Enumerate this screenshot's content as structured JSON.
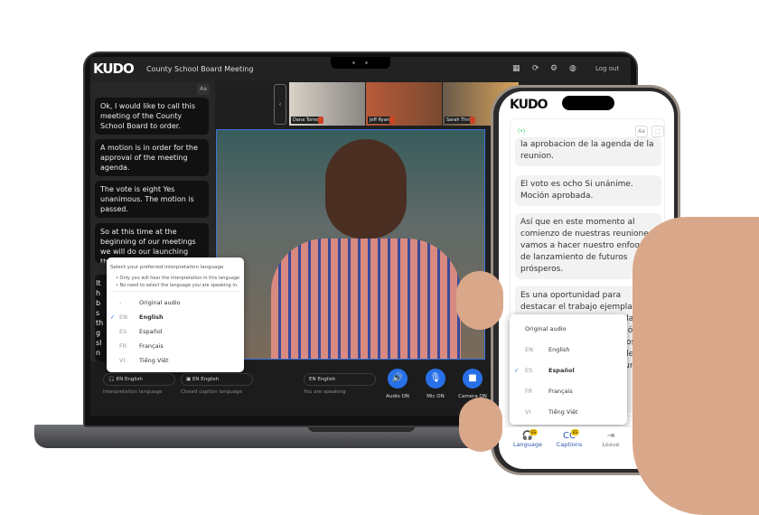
{
  "laptop": {
    "app": {
      "logo": "KUDO",
      "meeting_title": "County School Board Meeting",
      "logout": "Log out",
      "top_icons": [
        "layout-icon",
        "refresh-icon",
        "gear-icon",
        "globe-icon"
      ]
    },
    "captions": {
      "font_button": "Aa",
      "items": [
        "Ok, I would like to call this meeting of the County School Board to order.",
        "A motion is in order for the approval of the meeting agenda.",
        "The vote is eight Yes unanimous. The motion is passed.",
        "So at this time at the beginning of our meetings we will do our launching thriving fu",
        "It\nh\nb\ns\nth\ng\nsl\nn"
      ]
    },
    "participants": [
      {
        "name": "Dana Torres"
      },
      {
        "name": "Jeff Ryan"
      },
      {
        "name": "Sarah Thrift"
      }
    ],
    "language_dropdown": {
      "heading": "Select your preferred interpretation language",
      "notes": [
        "Only you will hear the interpretation in this language",
        "No need to select the language you are speaking in."
      ],
      "options": [
        {
          "code": "-",
          "label": "Original audio",
          "selected": false
        },
        {
          "code": "EN",
          "label": "English",
          "selected": true
        },
        {
          "code": "ES",
          "label": "Español",
          "selected": false
        },
        {
          "code": "FR",
          "label": "Français",
          "selected": false
        },
        {
          "code": "VI",
          "label": "Tiếng Việt",
          "selected": false
        }
      ]
    },
    "controls": {
      "interpretation": {
        "value": "EN English",
        "label": "Interpretation language"
      },
      "closed_caption": {
        "value": "EN English",
        "label": "Closed caption language"
      },
      "speaking": {
        "value": "EN English",
        "label": "You are speaking"
      },
      "audio": "Audio ON",
      "mic": "Mic ON",
      "camera": "Camera ON"
    },
    "accent": "#2870e8"
  },
  "phone": {
    "logo": "KUDO",
    "font_button": "Aa",
    "captions": [
      "la aprobacion de la agenda de la reunion.",
      "El voto es ocho Si unánime. Moción aprobada.",
      "Así que en este momento al comienzo de nuestras reuniones vamos a hacer nuestro enfoque de lanzamiento de futuros prósperos.",
      "Es una oportunidad para destacar el trabajo ejemplar que"
    ],
    "hidden_fragments": [
      "elas",
      "isión",
      "entos,",
      "ales",
      "turo"
    ],
    "language_dropdown": {
      "options": [
        {
          "code": "",
          "label": "Original audio",
          "selected": false
        },
        {
          "code": "EN",
          "label": "English",
          "selected": false
        },
        {
          "code": "ES",
          "label": "Español",
          "selected": true
        },
        {
          "code": "FR",
          "label": "Français",
          "selected": false
        },
        {
          "code": "VI",
          "label": "Tiếng Việt",
          "selected": false
        }
      ]
    },
    "nav": [
      {
        "label": "Language",
        "badge": "ES",
        "icon": "headphones-icon"
      },
      {
        "label": "Captions",
        "badge": "ES",
        "icon": "captions-icon"
      },
      {
        "label": "Leave",
        "icon": "leave-icon"
      },
      {
        "label": "",
        "icon": "menu-icon"
      }
    ]
  }
}
